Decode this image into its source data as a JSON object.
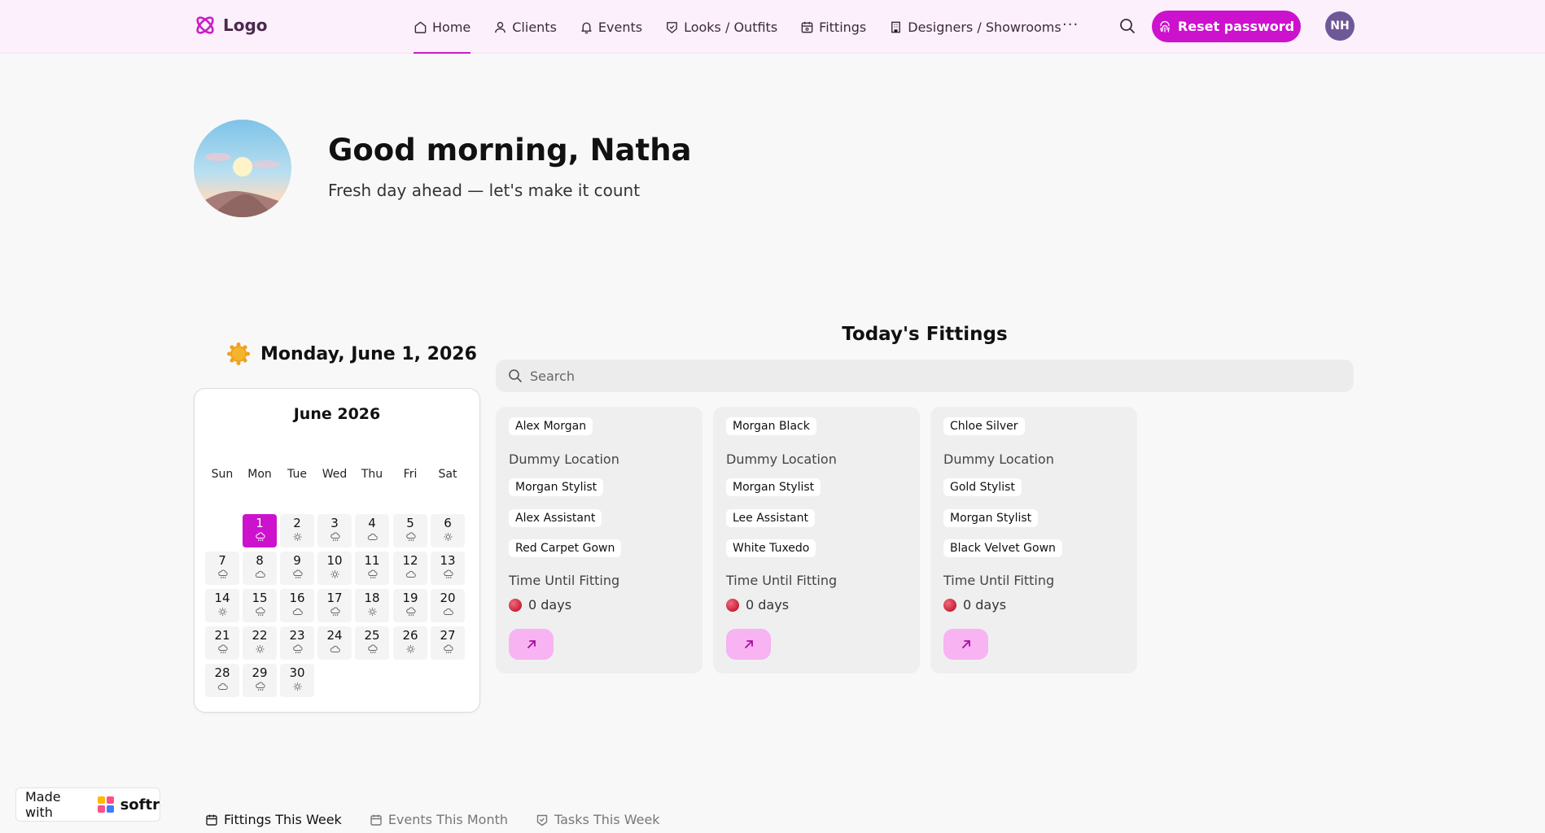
{
  "header": {
    "logo_text": "Logo",
    "nav": [
      {
        "label": "Home",
        "icon": "home-icon",
        "active": true
      },
      {
        "label": "Clients",
        "icon": "user-icon"
      },
      {
        "label": "Events",
        "icon": "bell-icon"
      },
      {
        "label": "Looks / Outfits",
        "icon": "tag-icon"
      },
      {
        "label": "Fittings",
        "icon": "calendar-icon"
      },
      {
        "label": "Designers / Showrooms",
        "icon": "building-icon"
      }
    ],
    "more_label": "···",
    "reset_label": "Reset password",
    "avatar_initials": "NH",
    "accent": "#cc12cc"
  },
  "greeting": {
    "title": "Good morning, Natha",
    "subtitle": "Fresh day ahead — let's make it count"
  },
  "date_label": "Monday, June 1, 2026",
  "calendar": {
    "title": "June 2026",
    "weekdays": [
      "Sun",
      "Mon",
      "Tue",
      "Wed",
      "Thu",
      "Fri",
      "Sat"
    ],
    "selected_day": "1",
    "days": [
      {
        "d": "1",
        "w": "rain"
      },
      {
        "d": "2",
        "w": "sun"
      },
      {
        "d": "3",
        "w": "rain"
      },
      {
        "d": "4",
        "w": "cloud"
      },
      {
        "d": "5",
        "w": "rain"
      },
      {
        "d": "6",
        "w": "sun"
      },
      {
        "d": "7",
        "w": "rain"
      },
      {
        "d": "8",
        "w": "cloud"
      },
      {
        "d": "9",
        "w": "rain"
      },
      {
        "d": "10",
        "w": "sun"
      },
      {
        "d": "11",
        "w": "rain"
      },
      {
        "d": "12",
        "w": "cloud"
      },
      {
        "d": "13",
        "w": "rain"
      },
      {
        "d": "14",
        "w": "sun"
      },
      {
        "d": "15",
        "w": "rain"
      },
      {
        "d": "16",
        "w": "cloud"
      },
      {
        "d": "17",
        "w": "rain"
      },
      {
        "d": "18",
        "w": "sun"
      },
      {
        "d": "19",
        "w": "rain"
      },
      {
        "d": "20",
        "w": "cloud"
      },
      {
        "d": "21",
        "w": "rain"
      },
      {
        "d": "22",
        "w": "sun"
      },
      {
        "d": "23",
        "w": "rain"
      },
      {
        "d": "24",
        "w": "cloud"
      },
      {
        "d": "25",
        "w": "rain"
      },
      {
        "d": "26",
        "w": "sun"
      },
      {
        "d": "27",
        "w": "rain"
      },
      {
        "d": "28",
        "w": "cloud"
      },
      {
        "d": "29",
        "w": "rain"
      },
      {
        "d": "30",
        "w": "sun"
      }
    ]
  },
  "fittings": {
    "title": "Today's Fittings",
    "search_placeholder": "Search",
    "cards": [
      {
        "client": "Alex Morgan",
        "location": "Dummy Location",
        "stylist": "Morgan Stylist",
        "assistant": "Alex Assistant",
        "look": "Red Carpet Gown",
        "time_label": "Time Until Fitting",
        "days": "0 days"
      },
      {
        "client": "Morgan Black",
        "location": "Dummy Location",
        "stylist": "Morgan Stylist",
        "assistant": "Lee Assistant",
        "look": "White Tuxedo",
        "time_label": "Time Until Fitting",
        "days": "0 days"
      },
      {
        "client": "Chloe Silver",
        "location": "Dummy Location",
        "stylist": "Gold Stylist",
        "assistant": "Morgan Stylist",
        "look": "Black Velvet Gown",
        "time_label": "Time Until Fitting",
        "days": "0 days"
      }
    ]
  },
  "badge": {
    "made_with": "Made with",
    "brand": "softr"
  },
  "tabs": [
    {
      "label": "Fittings This Week",
      "active": true
    },
    {
      "label": "Events This Month"
    },
    {
      "label": "Tasks This Week"
    }
  ]
}
